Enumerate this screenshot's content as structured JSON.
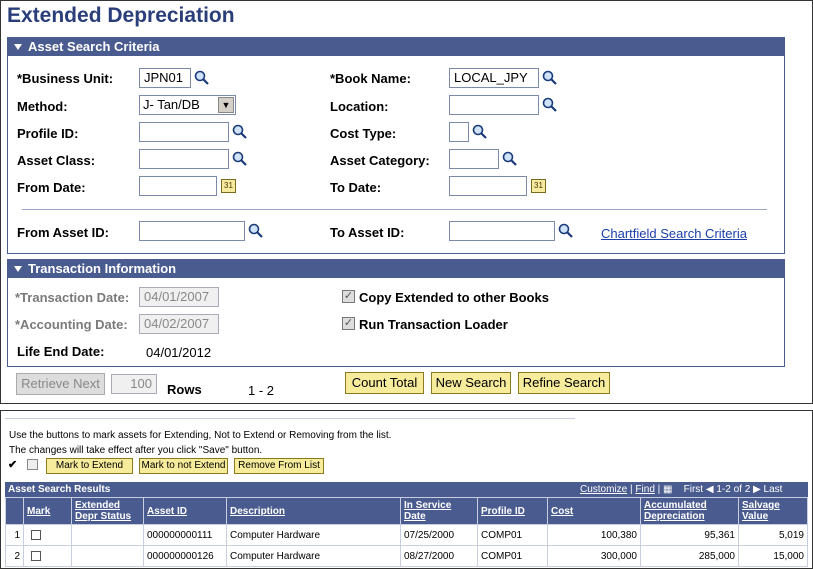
{
  "page": {
    "title": "Extended Depreciation"
  },
  "search_criteria": {
    "header": "Asset Search Criteria",
    "business_unit": {
      "label": "*Business Unit:",
      "value": "JPN01"
    },
    "book_name": {
      "label": "*Book Name:",
      "value": "LOCAL_JPY"
    },
    "method": {
      "label": "Method:",
      "value": "J- Tan/DB"
    },
    "location": {
      "label": "Location:",
      "value": ""
    },
    "profile_id": {
      "label": "Profile ID:",
      "value": ""
    },
    "cost_type": {
      "label": "Cost Type:",
      "value": ""
    },
    "asset_class": {
      "label": "Asset Class:",
      "value": ""
    },
    "asset_category": {
      "label": "Asset Category:",
      "value": ""
    },
    "from_date": {
      "label": "From Date:",
      "value": ""
    },
    "to_date": {
      "label": "To Date:",
      "value": ""
    },
    "from_asset_id": {
      "label": "From Asset ID:",
      "value": ""
    },
    "to_asset_id": {
      "label": "To Asset ID:",
      "value": ""
    },
    "chartfield_link": "Chartfield Search Criteria"
  },
  "transaction": {
    "header": "Transaction Information",
    "transaction_date": {
      "label": "*Transaction Date:",
      "value": "04/01/2007"
    },
    "accounting_date": {
      "label": "*Accounting Date:",
      "value": "04/02/2007"
    },
    "life_end_date": {
      "label": "Life End Date:",
      "value": "04/01/2012"
    },
    "copy_extended": {
      "label": "Copy Extended to other Books",
      "checked": true
    },
    "run_loader": {
      "label": "Run Transaction Loader",
      "checked": true
    }
  },
  "actions": {
    "retrieve_next": "Retrieve Next",
    "rows_value": "100",
    "rows_label": "Rows",
    "range": "1 -  2",
    "count_total": "Count Total",
    "new_search": "New Search",
    "refine_search": "Refine Search"
  },
  "results": {
    "instruction1": "Use the buttons to mark assets for Extending, Not to Extend or Removing from the list.",
    "instruction2": "The changes will take effect after you click \"Save\" button.",
    "mark_extend": "Mark to Extend",
    "mark_not_extend": "Mark to not Extend",
    "remove": "Remove From List",
    "title": "Asset Search Results",
    "nav": {
      "customize": "Customize",
      "sep": "|",
      "find": "Find",
      "first": "First",
      "range": "1-2 of 2",
      "last": "Last"
    },
    "columns": [
      "",
      "Mark",
      "Extended Depr Status",
      "Asset ID",
      "Description",
      "In Service Date",
      "Profile ID",
      "Cost",
      "Accumulated Depreciation",
      "Salvage Value"
    ],
    "rows": [
      {
        "n": "1",
        "status": "",
        "asset_id": "000000000111",
        "description": "Computer Hardware",
        "in_service": "07/25/2000",
        "profile": "COMP01",
        "cost": "100,380",
        "accum": "95,361",
        "salvage": "5,019"
      },
      {
        "n": "2",
        "status": "",
        "asset_id": "000000000126",
        "description": "Computer Hardware",
        "in_service": "08/27/2000",
        "profile": "COMP01",
        "cost": "300,000",
        "accum": "285,000",
        "salvage": "15,000"
      }
    ]
  }
}
